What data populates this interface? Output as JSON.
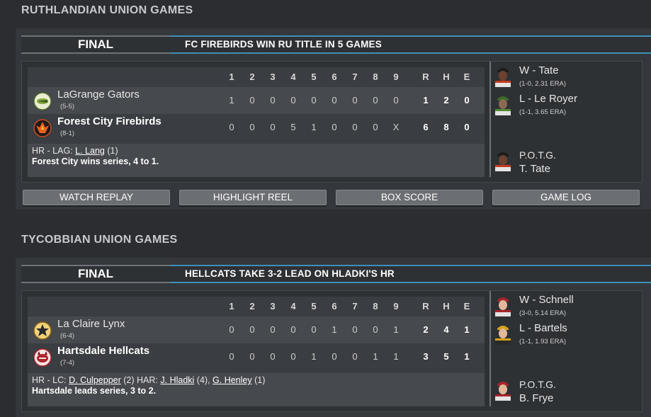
{
  "innings_header": [
    "1",
    "2",
    "3",
    "4",
    "5",
    "6",
    "7",
    "8",
    "9",
    "R",
    "H",
    "E"
  ],
  "leagues": [
    {
      "title": "RUTHLANDIAN UNION GAMES",
      "status": "FINAL",
      "headline": "FC FIREBIRDS WIN RU TITLE IN 5 GAMES",
      "away": {
        "name": "LaGrange Gators",
        "record": "(5-5)",
        "line": [
          "1",
          "0",
          "0",
          "0",
          "0",
          "0",
          "0",
          "0",
          "0",
          "1",
          "2",
          "0"
        ],
        "logo_color": "#7fa53a"
      },
      "home": {
        "name": "Forest City Firebirds",
        "record": "(8-1)",
        "line": [
          "0",
          "0",
          "0",
          "5",
          "1",
          "0",
          "0",
          "0",
          "X",
          "6",
          "8",
          "0"
        ],
        "logo_color": "#d2481f"
      },
      "hr_prefix": "HR - LAG:",
      "hr1": "L. Lang",
      "hr1_count": "(1)",
      "series_note": "Forest City wins series, 4 to 1.",
      "win": {
        "label": "W - Tate",
        "stat": "(1-0, 2.31 ERA)"
      },
      "loss": {
        "label": "L - Le Royer",
        "stat": "(1-1, 3.65 ERA)"
      },
      "potg_label": "P.O.T.G.",
      "potg_name": "T. Tate",
      "buttons": [
        "WATCH REPLAY",
        "HIGHLIGHT REEL",
        "BOX SCORE",
        "GAME LOG"
      ]
    },
    {
      "title": "TYCOBBIAN UNION GAMES",
      "status": "FINAL",
      "headline": "HELLCATS TAKE 3-2 LEAD ON HLADKI'S HR",
      "away": {
        "name": "La Claire Lynx",
        "record": "(6-4)",
        "line": [
          "0",
          "0",
          "0",
          "0",
          "0",
          "1",
          "0",
          "0",
          "1",
          "2",
          "4",
          "1"
        ],
        "logo_color": "#d4a21a"
      },
      "home": {
        "name": "Hartsdale Hellcats",
        "record": "(7-4)",
        "line": [
          "0",
          "0",
          "0",
          "0",
          "1",
          "0",
          "0",
          "1",
          "1",
          "3",
          "5",
          "1"
        ],
        "logo_color": "#b0242a"
      },
      "hr_prefix": "HR - LC:",
      "hr1": "D. Culpepper",
      "hr1_count": "(2)",
      "hr_prefix2": "HAR:",
      "hr2": "J. Hladki",
      "hr2_count": "(4),",
      "hr3": "G. Henley",
      "hr3_count": "(1)",
      "series_note": "Hartsdale leads series, 3 to 2.",
      "win": {
        "label": "W - Schnell",
        "stat": "(3-0, 5.14 ERA)"
      },
      "loss": {
        "label": "L - Bartels",
        "stat": "(1-1, 1.93 ERA)"
      },
      "potg_label": "P.O.T.G.",
      "potg_name": "B. Frye"
    }
  ]
}
